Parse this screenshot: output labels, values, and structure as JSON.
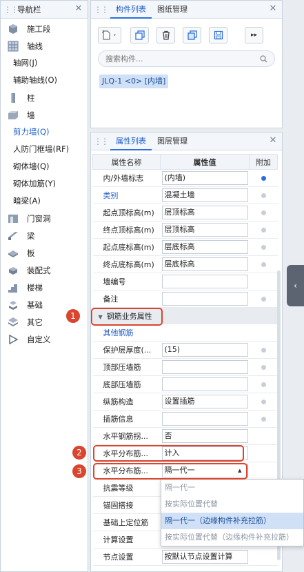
{
  "nav": {
    "title": "导航栏",
    "items": [
      {
        "label": "施工段",
        "type": "main",
        "icon": "construction-stage-icon"
      },
      {
        "label": "轴线",
        "type": "main",
        "icon": "grid-icon"
      },
      {
        "label": "轴网(J)",
        "type": "sub"
      },
      {
        "label": "辅助轴线(O)",
        "type": "sub"
      },
      {
        "label": "柱",
        "type": "main",
        "icon": "column-icon"
      },
      {
        "label": "墙",
        "type": "main",
        "icon": "wall-icon"
      },
      {
        "label": "剪力墙(Q)",
        "type": "sub",
        "selected": true
      },
      {
        "label": "人防门框墙(RF)",
        "type": "sub"
      },
      {
        "label": "砌体墙(Q)",
        "type": "sub"
      },
      {
        "label": "砌体加筋(Y)",
        "type": "sub"
      },
      {
        "label": "暗梁(A)",
        "type": "sub"
      },
      {
        "label": "门窗洞",
        "type": "main",
        "icon": "door-window-icon"
      },
      {
        "label": "梁",
        "type": "main",
        "icon": "beam-icon"
      },
      {
        "label": "板",
        "type": "main",
        "icon": "slab-icon"
      },
      {
        "label": "装配式",
        "type": "main",
        "icon": "prefab-icon"
      },
      {
        "label": "楼梯",
        "type": "main",
        "icon": "stairs-icon"
      },
      {
        "label": "基础",
        "type": "main",
        "icon": "foundation-icon"
      },
      {
        "label": "其它",
        "type": "main",
        "icon": "other-icon"
      },
      {
        "label": "自定义",
        "type": "main",
        "icon": "custom-icon"
      }
    ]
  },
  "components": {
    "tabs": [
      "构件列表",
      "图纸管理"
    ],
    "search_placeholder": "搜索构件...",
    "items": [
      "JLQ-1 <0> [内墙]"
    ]
  },
  "properties": {
    "tabs": [
      "属性列表",
      "图层管理"
    ],
    "headers": [
      "属性名称",
      "属性值",
      "附加"
    ],
    "rows": [
      {
        "name": "内/外墙标志",
        "value": "(内墙)",
        "dot": "on"
      },
      {
        "name": "类别",
        "value": "混凝土墙",
        "dot": "off",
        "blue": true
      },
      {
        "name": "起点顶标高(m)",
        "value": "层顶标高",
        "dot": "off"
      },
      {
        "name": "终点顶标高(m)",
        "value": "层顶标高",
        "dot": "off"
      },
      {
        "name": "起点底标高(m)",
        "value": "层底标高",
        "dot": "off"
      },
      {
        "name": "终点底标高(m)",
        "value": "层底标高",
        "dot": "off"
      },
      {
        "name": "墙编号",
        "value": "",
        "dot": ""
      },
      {
        "name": "备注",
        "value": "",
        "dot": "off"
      },
      {
        "group": "钢筋业务属性"
      },
      {
        "name": "其他钢筋",
        "value": null,
        "dot": "",
        "blue": true
      },
      {
        "name": "保护层厚度(...",
        "value": "(15)",
        "dot": "off"
      },
      {
        "name": "顶部压墙筋",
        "value": "",
        "dot": "off"
      },
      {
        "name": "底部压墙筋",
        "value": "",
        "dot": "off"
      },
      {
        "name": "纵筋构造",
        "value": "设置插筋",
        "dot": "off"
      },
      {
        "name": "插筋信息",
        "value": "",
        "dot": "off"
      },
      {
        "name": "水平钢筋拐...",
        "value": "否",
        "dot": ""
      },
      {
        "name": "水平分布筋...",
        "value": "计入",
        "dot": ""
      },
      {
        "name": "水平分布筋...",
        "value": "隔一代一",
        "dot": "",
        "dropdown": true
      },
      {
        "name": "抗震等级",
        "value": null,
        "dot": ""
      },
      {
        "name": "锚固搭接",
        "value": null,
        "dot": ""
      },
      {
        "name": "基础上定位筋",
        "value": null,
        "dot": ""
      },
      {
        "name": "计算设置",
        "value": null,
        "dot": ""
      },
      {
        "name": "节点设置",
        "value": "按默认节点设置计算",
        "dot": ""
      }
    ],
    "dropdown_options": [
      {
        "label": "隔一代一",
        "selected": false
      },
      {
        "label": "按实际位置代替",
        "selected": false
      },
      {
        "label": "隔一代一（边缘构件补充拉筋）",
        "selected": true
      },
      {
        "label": "按实际位置代替（边缘构件补充拉筋）",
        "selected": false
      }
    ]
  },
  "markers": [
    "1",
    "2",
    "3"
  ],
  "colors": {
    "accent": "#2a6fdb",
    "marker": "#d9452e",
    "selection": "#cfe0f7"
  }
}
